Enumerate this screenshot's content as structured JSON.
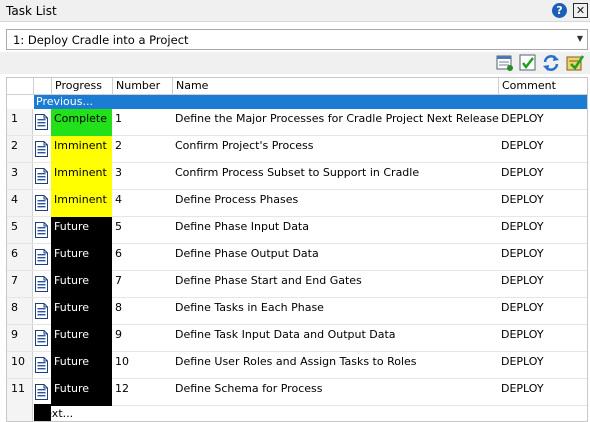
{
  "window": {
    "title": "Task List"
  },
  "project_selector": {
    "value": "1: Deploy Cradle into a Project"
  },
  "grid": {
    "columns": {
      "progress": "Progress",
      "number": "Number",
      "name": "Name",
      "comment": "Comment"
    },
    "previous_label": "Previous...",
    "next_label": "Next...",
    "rows": [
      {
        "row": "1",
        "progress": "Complete",
        "status": "complete",
        "number": "1",
        "name": "Define the Major Processes for Cradle Project Next Release",
        "comment": "DEPLOY"
      },
      {
        "row": "2",
        "progress": "Imminent",
        "status": "imminent",
        "number": "2",
        "name": "Confirm Project's Process",
        "comment": "DEPLOY"
      },
      {
        "row": "3",
        "progress": "Imminent",
        "status": "imminent",
        "number": "3",
        "name": "Confirm Process Subset to Support in Cradle",
        "comment": "DEPLOY"
      },
      {
        "row": "4",
        "progress": "Imminent",
        "status": "imminent",
        "number": "4",
        "name": "Define Process Phases",
        "comment": "DEPLOY"
      },
      {
        "row": "5",
        "progress": "Future",
        "status": "future",
        "number": "5",
        "name": "Define Phase Input Data",
        "comment": "DEPLOY"
      },
      {
        "row": "6",
        "progress": "Future",
        "status": "future",
        "number": "6",
        "name": "Define Phase Output Data",
        "comment": "DEPLOY"
      },
      {
        "row": "7",
        "progress": "Future",
        "status": "future",
        "number": "7",
        "name": "Define Phase Start and End Gates",
        "comment": "DEPLOY"
      },
      {
        "row": "8",
        "progress": "Future",
        "status": "future",
        "number": "8",
        "name": "Define Tasks in Each Phase",
        "comment": "DEPLOY"
      },
      {
        "row": "9",
        "progress": "Future",
        "status": "future",
        "number": "9",
        "name": "Define Task Input Data and Output Data",
        "comment": "DEPLOY"
      },
      {
        "row": "10",
        "progress": "Future",
        "status": "future",
        "number": "10",
        "name": "Define User Roles and Assign Tasks to Roles",
        "comment": "DEPLOY"
      },
      {
        "row": "11",
        "progress": "Future",
        "status": "future",
        "number": "12",
        "name": "Define Schema for Process",
        "comment": "DEPLOY"
      }
    ]
  },
  "colors": {
    "complete": "#22e11b",
    "imminent": "#ffff00",
    "future": "#000000",
    "selection": "#1c7bd2"
  },
  "icons": [
    "help-icon",
    "close-icon",
    "dropdown-arrow-icon",
    "view-task-icon",
    "complete-task-icon",
    "refresh-icon",
    "approve-task-icon",
    "document-icon"
  ]
}
